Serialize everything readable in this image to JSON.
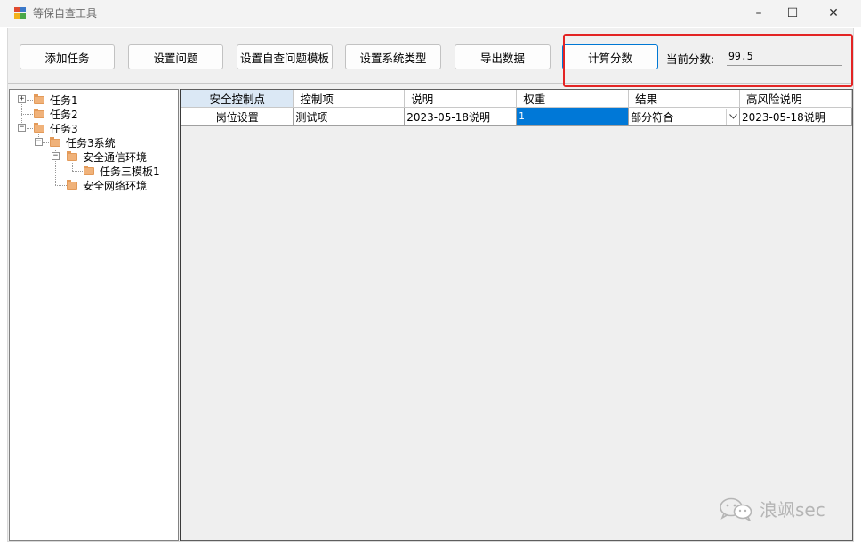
{
  "window": {
    "title": "等保自查工具",
    "controls": {
      "minimize": "–",
      "maximize": "☐",
      "close": "✕"
    }
  },
  "toolbar": {
    "buttons": [
      "添加任务",
      "设置问题",
      "设置自查问题模板",
      "设置系统类型",
      "导出数据",
      "计算分数"
    ],
    "score_label": "当前分数:",
    "score_value": "99.5"
  },
  "tree": {
    "nodes": [
      {
        "label": "任务1",
        "expander": "+"
      },
      {
        "label": "任务2"
      },
      {
        "label": "任务3",
        "expander": "−"
      },
      {
        "label": "任务3系统",
        "expander": "−"
      },
      {
        "label": "安全通信环境",
        "expander": "−"
      },
      {
        "label": "任务三模板1"
      },
      {
        "label": "安全网络环境"
      }
    ]
  },
  "grid": {
    "columns": [
      "安全控制点",
      "控制项",
      "说明",
      "权重",
      "结果",
      "高风险说明"
    ],
    "rows": [
      [
        "岗位设置",
        "测试项",
        "2023-05-18说明",
        "1",
        "部分符合",
        "2023-05-18说明"
      ]
    ]
  },
  "watermark": {
    "text": "浪飒sec",
    "icon": "wechat-icon"
  },
  "colors": {
    "highlight": "#e32424",
    "selection": "#0078d7",
    "header_selected": "#dbe8f5"
  }
}
